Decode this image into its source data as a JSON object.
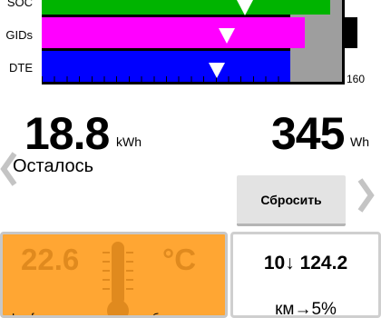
{
  "gauge": {
    "labels": {
      "soc": "SOC",
      "gids": "GIDs",
      "dte": "DTE"
    },
    "scale_max": "160",
    "colors": {
      "soc": "#00b400",
      "gids": "#ff00ff",
      "dte": "#0000ff",
      "background": "#000000",
      "reserve": "#9e9e9e"
    }
  },
  "energy": {
    "remaining_value": "18.8",
    "remaining_unit": "kWh",
    "remaining_label": "Осталось",
    "counter_value": "345",
    "counter_unit": "Wh"
  },
  "controls": {
    "reset_label": "Сбросить",
    "prev_icon": "chevron-left-icon",
    "next_icon": "chevron-right-icon"
  },
  "temperature": {
    "value": "22.6",
    "unit": "°C",
    "note": "Lcof  воприм  движите  угтобы",
    "panel_color": "#ffa633"
  },
  "consumption": {
    "top": "10↓ 124.2",
    "bottom": "км→5%"
  }
}
